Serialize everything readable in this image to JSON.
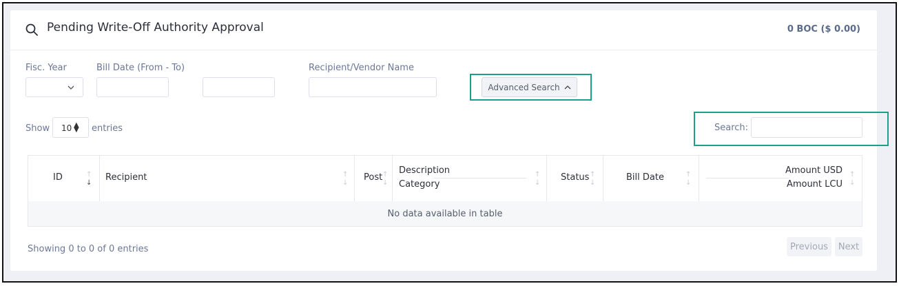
{
  "header": {
    "title": "Pending Write-Off Authority Approval",
    "total": "0 BOC ($ 0.00)"
  },
  "filters": {
    "fiscal_year_label": "Fisc. Year",
    "bill_date_label": "Bill Date (From - To)",
    "recipient_label": "Recipient/Vendor Name",
    "advanced_search_label": "Advanced Search"
  },
  "length": {
    "show_label": "Show",
    "value": "10",
    "entries_label": "entries"
  },
  "search": {
    "label": "Search:",
    "value": ""
  },
  "table": {
    "columns": {
      "id": "ID",
      "recipient": "Recipient",
      "post": "Post",
      "description": "Description",
      "category": "Category",
      "status": "Status",
      "bill_date": "Bill Date",
      "amount_usd": "Amount USD",
      "amount_lcu": "Amount LCU"
    },
    "empty_message": "No data available in table"
  },
  "footer": {
    "info": "Showing 0 to 0 of 0 entries",
    "previous": "Previous",
    "next": "Next"
  },
  "colors": {
    "highlight": "#1b9e8a",
    "total_text": "#5a6a8a"
  }
}
